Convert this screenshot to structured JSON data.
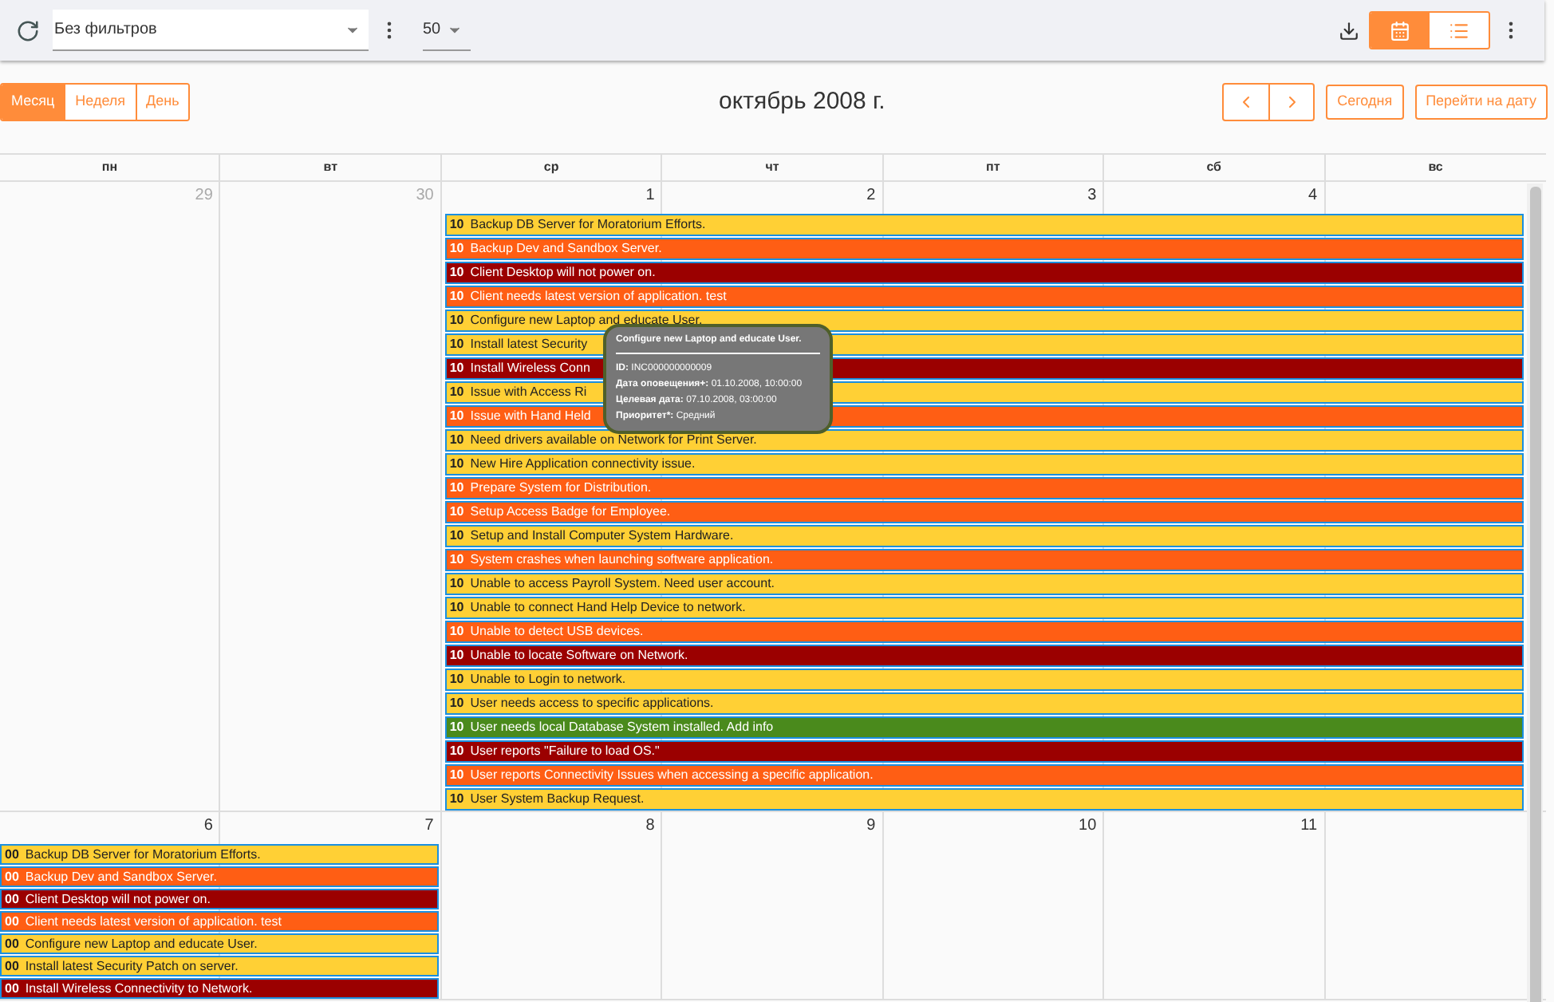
{
  "toolbar": {
    "filter": {
      "value": "Без фильтров"
    },
    "page_size": {
      "value": "50"
    },
    "view_toggle": [
      {
        "kind": "calendar",
        "selected": true
      },
      {
        "kind": "list",
        "selected": false
      }
    ]
  },
  "views": [
    {
      "label": "Месяц",
      "selected": true
    },
    {
      "label": "Неделя",
      "selected": false
    },
    {
      "label": "День",
      "selected": false
    }
  ],
  "title": "октябрь 2008 г.",
  "nav": {
    "today": "Сегодня",
    "goto": "Перейти на дату"
  },
  "weekdays": [
    "пн",
    "вт",
    "ср",
    "чт",
    "пт",
    "сб",
    "вс"
  ],
  "weeks": [
    {
      "days": [
        {
          "label": "29",
          "other_month": true
        },
        {
          "label": "30",
          "other_month": true
        },
        {
          "label": "1",
          "other_month": false
        },
        {
          "label": "2",
          "other_month": false
        },
        {
          "label": "3",
          "other_month": false
        },
        {
          "label": "4",
          "other_month": false
        }
      ],
      "events": [
        {
          "count": "10",
          "title": "Backup DB Server for Moratorium Efforts.",
          "color": "#ffd035"
        },
        {
          "count": "10",
          "title": "Backup Dev and Sandbox Server.",
          "color": "#ff5e14"
        },
        {
          "count": "10",
          "title": "Client Desktop will not power on.",
          "color": "#9b0000"
        },
        {
          "count": "10",
          "title": "Client needs latest version of application. test",
          "color": "#ff5e14"
        },
        {
          "count": "10",
          "title": "Configure new Laptop and educate User.",
          "color": "#ffd035"
        },
        {
          "count": "10",
          "title": "Install latest Security",
          "color": "#ffd035"
        },
        {
          "count": "10",
          "title": "Install Wireless Conn",
          "color": "#9b0000"
        },
        {
          "count": "10",
          "title": "Issue with Access Ri",
          "color": "#ffd035"
        },
        {
          "count": "10",
          "title": "Issue with Hand Held",
          "color": "#ff5e14"
        },
        {
          "count": "10",
          "title": "Need drivers available on Network for Print Server.",
          "color": "#ffd035"
        },
        {
          "count": "10",
          "title": "New Hire Application connectivity issue.",
          "color": "#ffd035"
        },
        {
          "count": "10",
          "title": "Prepare System for Distribution.",
          "color": "#ff5e14"
        },
        {
          "count": "10",
          "title": "Setup Access Badge for Employee.",
          "color": "#ff5e14"
        },
        {
          "count": "10",
          "title": "Setup and Install Computer System Hardware.",
          "color": "#ffd035"
        },
        {
          "count": "10",
          "title": "System crashes when launching software application.",
          "color": "#ff5e14"
        },
        {
          "count": "10",
          "title": "Unable to access Payroll System. Need user account.",
          "color": "#ffd035"
        },
        {
          "count": "10",
          "title": "Unable to connect Hand Help Device to network.",
          "color": "#ffd035"
        },
        {
          "count": "10",
          "title": "Unable to detect USB devices.",
          "color": "#ff5e14"
        },
        {
          "count": "10",
          "title": "Unable to locate Software on Network.",
          "color": "#9b0000"
        },
        {
          "count": "10",
          "title": "Unable to Login to network.",
          "color": "#ffd035"
        },
        {
          "count": "10",
          "title": "User needs access to specific applications.",
          "color": "#ffd035"
        },
        {
          "count": "10",
          "title": "User needs local Database System installed. Add info",
          "color": "#4a8a1c"
        },
        {
          "count": "10",
          "title": "User reports \"Failure to load OS.\"",
          "color": "#9b0000"
        },
        {
          "count": "10",
          "title": "User reports Connectivity Issues when accessing a specific application.",
          "color": "#ff5e14"
        },
        {
          "count": "10",
          "title": "User System Backup Request.",
          "color": "#ffd035"
        }
      ]
    },
    {
      "days": [
        {
          "label": "6",
          "other_month": false
        },
        {
          "label": "7",
          "other_month": false
        },
        {
          "label": "8",
          "other_month": false
        },
        {
          "label": "9",
          "other_month": false
        },
        {
          "label": "10",
          "other_month": false
        },
        {
          "label": "11",
          "other_month": false
        }
      ],
      "events": [
        {
          "count": "00",
          "title": "Backup DB Server for Moratorium Efforts.",
          "color": "#ffd035"
        },
        {
          "count": "00",
          "title": "Backup Dev and Sandbox Server.",
          "color": "#ff5e14"
        },
        {
          "count": "00",
          "title": "Client Desktop will not power on.",
          "color": "#9b0000"
        },
        {
          "count": "00",
          "title": "Client needs latest version of application. test",
          "color": "#ff5e14"
        },
        {
          "count": "00",
          "title": "Configure new Laptop and educate User.",
          "color": "#ffd035"
        },
        {
          "count": "00",
          "title": "Install latest Security Patch on server.",
          "color": "#ffd035"
        },
        {
          "count": "00",
          "title": "Install Wireless Connectivity to Network.",
          "color": "#9b0000"
        }
      ]
    }
  ],
  "tooltip": {
    "title": "Configure new Laptop and educate User.",
    "lines": [
      {
        "label": "ID:",
        "value": "INC000000000009"
      },
      {
        "label": "Дата оповещения+:",
        "value": "01.10.2008, 10:00:00"
      },
      {
        "label": "Целевая дата:",
        "value": "07.10.2008, 03:00:00"
      },
      {
        "label": "Приоритет*:",
        "value": "Средний"
      }
    ]
  }
}
